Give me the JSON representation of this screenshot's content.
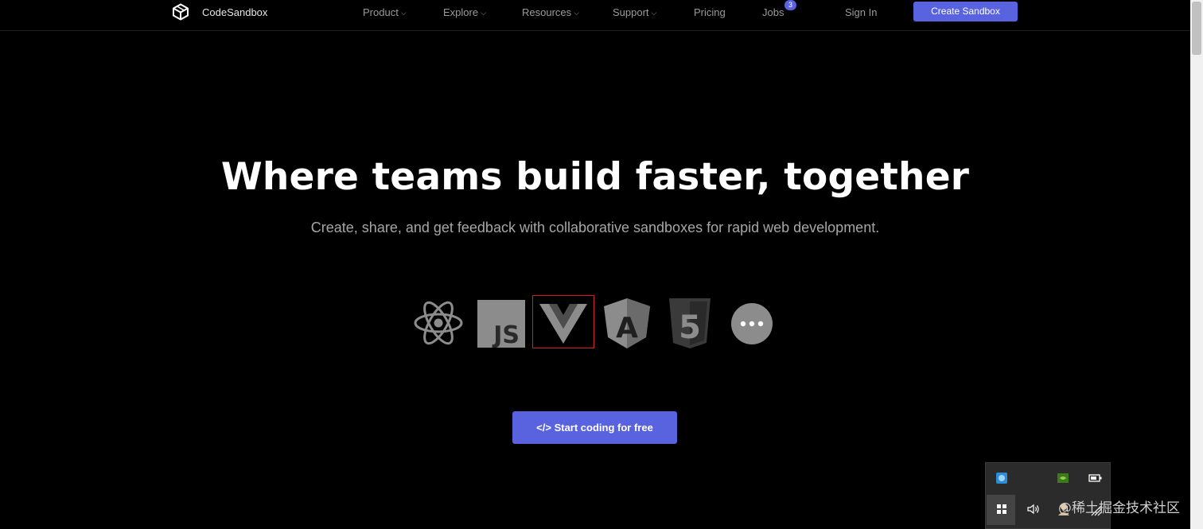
{
  "header": {
    "brand": "CodeSandbox",
    "nav": [
      {
        "label": "Product",
        "dropdown": true
      },
      {
        "label": "Explore",
        "dropdown": true
      },
      {
        "label": "Resources",
        "dropdown": true
      },
      {
        "label": "Support",
        "dropdown": true
      },
      {
        "label": "Pricing",
        "dropdown": false
      },
      {
        "label": "Jobs",
        "dropdown": false
      }
    ],
    "jobs_badge": "3",
    "sign_in": "Sign In",
    "create_sandbox": "Create Sandbox",
    "accent": "#5962df"
  },
  "hero": {
    "title": "Where teams build faster, together",
    "subtitle": "Create, share, and get feedback with collaborative sandboxes for rapid web development.",
    "frameworks": [
      {
        "name": "react-icon"
      },
      {
        "name": "javascript-icon",
        "text": "JS"
      },
      {
        "name": "vue-icon",
        "selected": true
      },
      {
        "name": "angular-icon",
        "text": "A"
      },
      {
        "name": "html5-icon",
        "text": "5"
      },
      {
        "name": "more-icon"
      }
    ],
    "cta": "</> Start coding for free"
  },
  "tray": {
    "icons": [
      "network-app-icon",
      "nvidia-icon",
      "battery-icon",
      "start-icon",
      "volume-icon",
      "user-icon",
      "wifi-icon"
    ],
    "watermark": "@稀土掘金技术社区"
  }
}
